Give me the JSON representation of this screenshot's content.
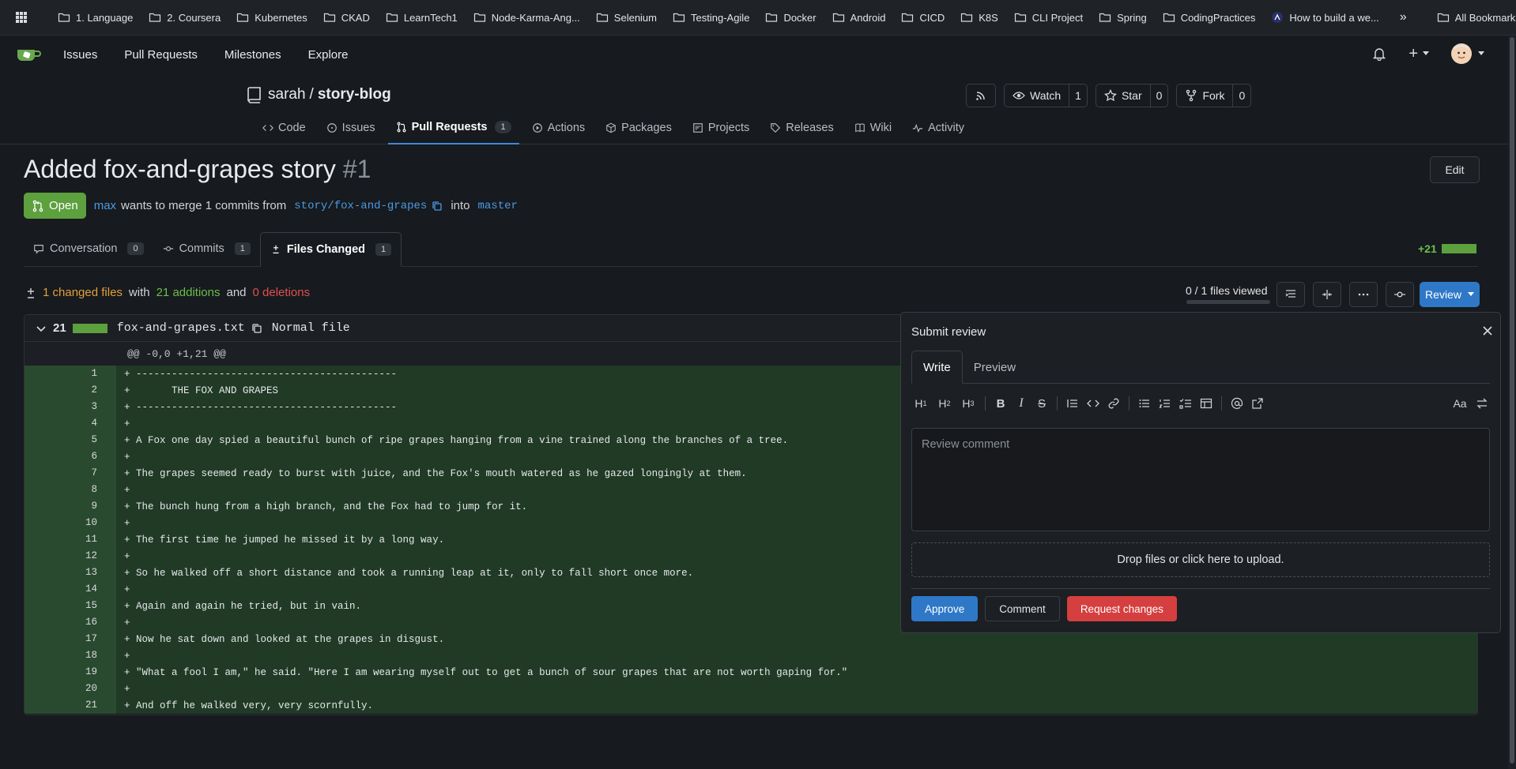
{
  "bookmarks": {
    "items": [
      {
        "label": "1. Language"
      },
      {
        "label": "2. Coursera"
      },
      {
        "label": "Kubernetes"
      },
      {
        "label": "CKAD"
      },
      {
        "label": "LearnTech1"
      },
      {
        "label": "Node-Karma-Ang..."
      },
      {
        "label": "Selenium"
      },
      {
        "label": "Testing-Agile"
      },
      {
        "label": "Docker"
      },
      {
        "label": "Android"
      },
      {
        "label": "CICD"
      },
      {
        "label": "K8S"
      },
      {
        "label": "CLI Project"
      },
      {
        "label": "Spring"
      },
      {
        "label": "CodingPractices"
      },
      {
        "label": "How to build a we..."
      }
    ],
    "more": "»",
    "all_bookmarks": "All Bookmarks"
  },
  "nav": {
    "issues": "Issues",
    "pull_requests": "Pull Requests",
    "milestones": "Milestones",
    "explore": "Explore",
    "plus": "+"
  },
  "repo": {
    "owner": "sarah",
    "slash": "/",
    "name": "story-blog",
    "watch_label": "Watch",
    "watch_count": "1",
    "star_label": "Star",
    "star_count": "0",
    "fork_label": "Fork",
    "fork_count": "0",
    "tabs": [
      {
        "label": "Code"
      },
      {
        "label": "Issues"
      },
      {
        "label": "Pull Requests",
        "badge": "1"
      },
      {
        "label": "Actions"
      },
      {
        "label": "Packages"
      },
      {
        "label": "Projects"
      },
      {
        "label": "Releases"
      },
      {
        "label": "Wiki"
      },
      {
        "label": "Activity"
      }
    ]
  },
  "pr": {
    "title": "Added fox-and-grapes story",
    "number": "#1",
    "edit_label": "Edit",
    "status": "Open",
    "author": "max",
    "merge_text": "wants to merge 1 commits from",
    "source_branch": "story/fox-and-grapes",
    "into_text": "into",
    "target_branch": "master",
    "tabs": [
      {
        "label": "Conversation",
        "count": "0"
      },
      {
        "label": "Commits",
        "count": "1"
      },
      {
        "label": "Files Changed",
        "count": "1"
      }
    ],
    "additions_badge": "+21"
  },
  "summary": {
    "changed": "1 changed files",
    "with": "with",
    "additions": "21 additions",
    "and": "and",
    "deletions": "0 deletions",
    "files_viewed": "0 / 1 files viewed",
    "review_label": "Review"
  },
  "file": {
    "count": "21",
    "name": "fox-and-grapes.txt",
    "type": "Normal file",
    "hunk": "@@ -0,0 +1,21 @@",
    "lines": [
      {
        "n": "1",
        "text": "+ --------------------------------------------"
      },
      {
        "n": "2",
        "text": "+       THE FOX AND GRAPES"
      },
      {
        "n": "3",
        "text": "+ --------------------------------------------"
      },
      {
        "n": "4",
        "text": "+"
      },
      {
        "n": "5",
        "text": "+ A Fox one day spied a beautiful bunch of ripe grapes hanging from a vine trained along the branches of a tree."
      },
      {
        "n": "6",
        "text": "+"
      },
      {
        "n": "7",
        "text": "+ The grapes seemed ready to burst with juice, and the Fox's mouth watered as he gazed longingly at them."
      },
      {
        "n": "8",
        "text": "+"
      },
      {
        "n": "9",
        "text": "+ The bunch hung from a high branch, and the Fox had to jump for it."
      },
      {
        "n": "10",
        "text": "+"
      },
      {
        "n": "11",
        "text": "+ The first time he jumped he missed it by a long way."
      },
      {
        "n": "12",
        "text": "+"
      },
      {
        "n": "13",
        "text": "+ So he walked off a short distance and took a running leap at it, only to fall short once more."
      },
      {
        "n": "14",
        "text": "+"
      },
      {
        "n": "15",
        "text": "+ Again and again he tried, but in vain."
      },
      {
        "n": "16",
        "text": "+"
      },
      {
        "n": "17",
        "text": "+ Now he sat down and looked at the grapes in disgust."
      },
      {
        "n": "18",
        "text": "+"
      },
      {
        "n": "19",
        "text": "+ \"What a fool I am,\" he said. \"Here I am wearing myself out to get a bunch of sour grapes that are not worth gaping for.\""
      },
      {
        "n": "20",
        "text": "+"
      },
      {
        "n": "21",
        "text": "+ And off he walked very, very scornfully."
      }
    ]
  },
  "review": {
    "title": "Submit review",
    "tab_write": "Write",
    "tab_preview": "Preview",
    "placeholder": "Review comment",
    "dropzone": "Drop files or click here to upload.",
    "approve": "Approve",
    "comment": "Comment",
    "request_changes": "Request changes",
    "font_toggle": "Aa"
  },
  "colors": {
    "accent": "#2e78c7",
    "open": "#5da03e",
    "danger": "#d63f3f",
    "addition_bg": "#203a26"
  }
}
